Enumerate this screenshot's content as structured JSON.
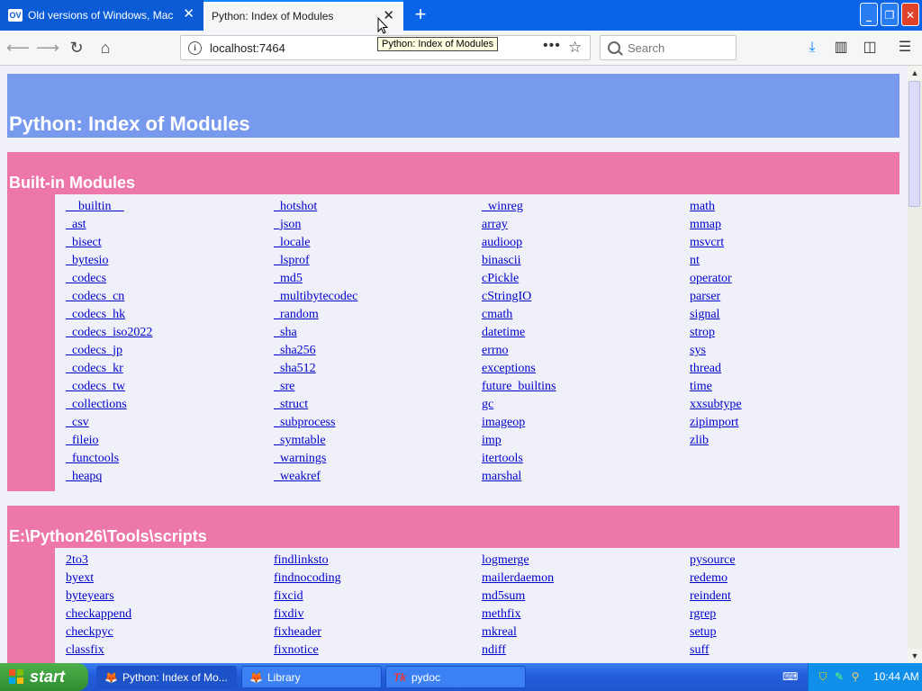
{
  "browser": {
    "tabs": [
      {
        "label": "Old versions of Windows, Mac and",
        "favicon": "OV"
      },
      {
        "label": "Python: Index of Modules"
      }
    ],
    "url": "localhost:7464",
    "search_placeholder": "Search",
    "tooltip": "Python: Index of Modules"
  },
  "page": {
    "title": "Python: Index of Modules",
    "sections": [
      {
        "heading": "Built-in Modules",
        "columns": [
          [
            "__builtin__",
            "_ast",
            "_bisect",
            "_bytesio",
            "_codecs",
            "_codecs_cn",
            "_codecs_hk",
            "_codecs_iso2022",
            "_codecs_jp",
            "_codecs_kr",
            "_codecs_tw",
            "_collections",
            "_csv",
            "_fileio",
            "_functools",
            "_heapq"
          ],
          [
            "_hotshot",
            "_json",
            "_locale",
            "_lsprof",
            "_md5",
            "_multibytecodec",
            "_random",
            "_sha",
            "_sha256",
            "_sha512",
            "_sre",
            "_struct",
            "_subprocess",
            "_symtable",
            "_warnings",
            "_weakref"
          ],
          [
            "_winreg",
            "array",
            "audioop",
            "binascii",
            "cPickle",
            "cStringIO",
            "cmath",
            "datetime",
            "errno",
            "exceptions",
            "future_builtins",
            "gc",
            "imageop",
            "imp",
            "itertools",
            "marshal"
          ],
          [
            "math",
            "mmap",
            "msvcrt",
            "nt",
            "operator",
            "parser",
            "signal",
            "strop",
            "sys",
            "thread",
            "time",
            "xxsubtype",
            "zipimport",
            "zlib"
          ]
        ]
      },
      {
        "heading": "E:\\Python26\\Tools\\scripts",
        "columns": [
          [
            "2to3",
            "byext",
            "byteyears",
            "checkappend",
            "checkpyc",
            "classfix"
          ],
          [
            "findlinksto",
            "findnocoding",
            "fixcid",
            "fixdiv",
            "fixheader",
            "fixnotice"
          ],
          [
            "logmerge",
            "mailerdaemon",
            "md5sum",
            "methfix",
            "mkreal",
            "ndiff"
          ],
          [
            "pysource",
            "redemo",
            "reindent",
            "rgrep",
            "setup",
            "suff"
          ]
        ]
      }
    ]
  },
  "taskbar": {
    "start": "start",
    "tasks": [
      {
        "label": "Python: Index of Mo...",
        "icon": "firefox-icon"
      },
      {
        "label": "Library",
        "icon": "library-icon"
      },
      {
        "label": "pydoc",
        "icon": "tk-icon"
      }
    ],
    "clock": "10:44 AM"
  }
}
